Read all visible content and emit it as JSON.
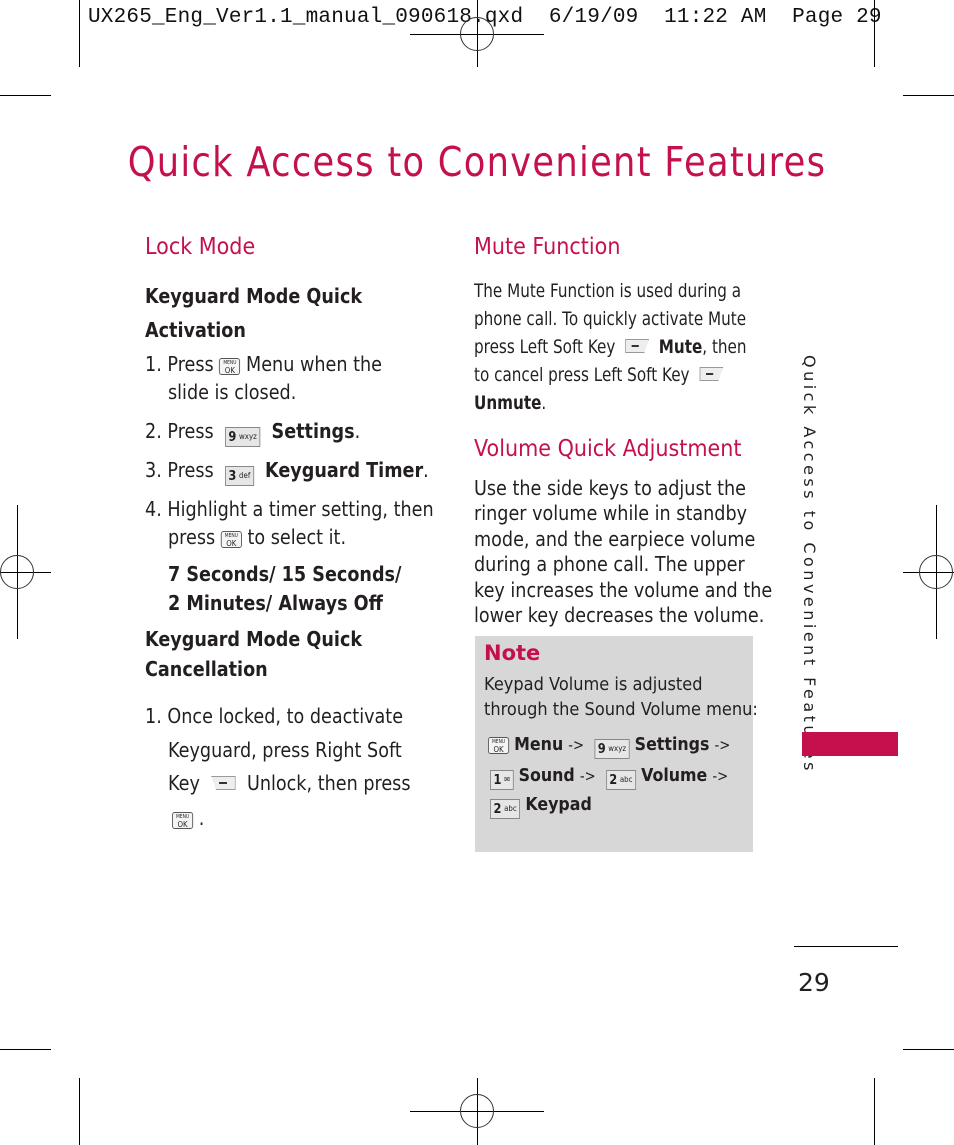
{
  "slug": "UX265_Eng_Ver1.1_manual_090618.qxd  6/19/09  11:22 AM  Page 29",
  "title": "Quick Access to Convenient Features",
  "accent_color": "#c4114d",
  "note_bg_color": "#d7d7d7",
  "lock_mode": {
    "heading": "Lock Mode",
    "activation_heading_1": "Keyguard Mode Quick",
    "activation_heading_2": "Activation",
    "step1_prefix": "1. Press",
    "step1_suffix": "Menu when the",
    "step1_line2": "slide is closed.",
    "step2_prefix": "2. Press",
    "step2_label": "Settings",
    "step3_prefix": "3. Press",
    "step3_label": "Keyguard Timer",
    "step4_line1": "4. Highlight a timer setting, then",
    "step4_prefix": "press",
    "step4_suffix": "to select it.",
    "options_line1": "7 Seconds/ 15 Seconds/",
    "options_line2": "2 Minutes/ Always Off",
    "cancel_heading_1": "Keyguard Mode Quick",
    "cancel_heading_2": "Cancellation",
    "cancel_line1": "1. Once locked, to deactivate",
    "cancel_line2": "Keyguard, press Right Soft",
    "cancel_line3_prefix": "Key",
    "cancel_line3_suffix": "Unlock, then press",
    "period": "."
  },
  "mute_function": {
    "heading": "Mute Function",
    "line1": "The Mute Function is used during a",
    "line2": "phone call. To quickly activate Mute",
    "line3_prefix": "press Left Soft Key",
    "line3_bold": "Mute",
    "line3_suffix": ", then",
    "line4": "to cancel press Left Soft Key",
    "line5_bold": "Unmute",
    "period": "."
  },
  "volume": {
    "heading": "Volume Quick Adjustment",
    "lines": [
      "Use the side keys to adjust the",
      "ringer volume while in standby",
      "mode, and the earpiece volume",
      "during a phone call. The upper",
      "key increases the volume and the",
      "lower key decreases the volume."
    ]
  },
  "note": {
    "title": "Note",
    "line1": "Keypad Volume is adjusted",
    "line2": "through the Sound Volume menu:",
    "menu": "Menu",
    "settings": "Settings",
    "sound": "Sound",
    "volume": "Volume",
    "keypad": "Keypad",
    "arrow": "->"
  },
  "keys": {
    "menu_top": "MENU",
    "menu_bottom": "OK",
    "k9": "9",
    "k9_letters": "wxyz",
    "k3": "3",
    "k3_letters": "def",
    "k2": "2",
    "k2_letters": "abc",
    "k1": "1",
    "k1_letters": "✉"
  },
  "side_tab": "Quick Access to Convenient Features",
  "page_number": "29"
}
